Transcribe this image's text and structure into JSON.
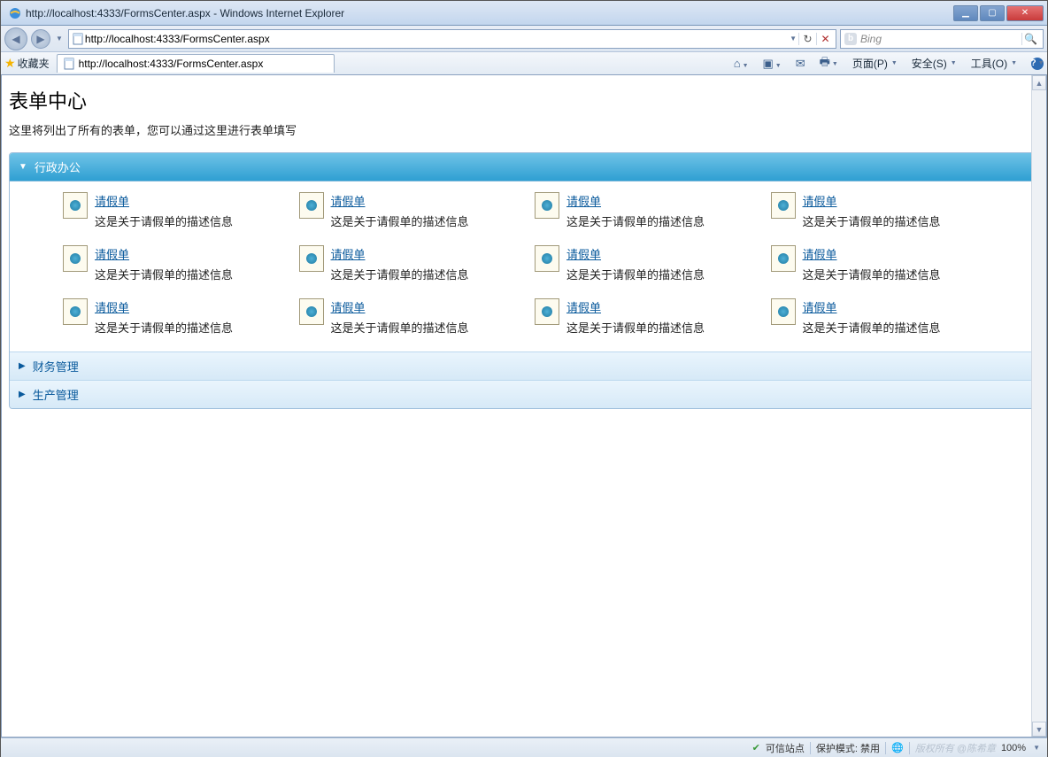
{
  "window": {
    "title": "http://localhost:4333/FormsCenter.aspx - Windows Internet Explorer",
    "url": "http://localhost:4333/FormsCenter.aspx"
  },
  "favorites": {
    "label": "收藏夹"
  },
  "tab": {
    "title": "http://localhost:4333/FormsCenter.aspx"
  },
  "search": {
    "placeholder": "Bing"
  },
  "commandbar": {
    "page": "页面(P)",
    "safety": "安全(S)",
    "tools": "工具(O)"
  },
  "page": {
    "title": "表单中心",
    "subtitle": "这里将列出了所有的表单，您可以通过这里进行表单填写"
  },
  "sections": [
    {
      "title": "行政办公",
      "expanded": true,
      "items": [
        {
          "title": "请假单",
          "desc": "这是关于请假单的描述信息"
        },
        {
          "title": "请假单",
          "desc": "这是关于请假单的描述信息"
        },
        {
          "title": "请假单",
          "desc": "这是关于请假单的描述信息"
        },
        {
          "title": "请假单",
          "desc": "这是关于请假单的描述信息"
        },
        {
          "title": "请假单",
          "desc": "这是关于请假单的描述信息"
        },
        {
          "title": "请假单",
          "desc": "这是关于请假单的描述信息"
        },
        {
          "title": "请假单",
          "desc": "这是关于请假单的描述信息"
        },
        {
          "title": "请假单",
          "desc": "这是关于请假单的描述信息"
        },
        {
          "title": "请假单",
          "desc": "这是关于请假单的描述信息"
        },
        {
          "title": "请假单",
          "desc": "这是关于请假单的描述信息"
        },
        {
          "title": "请假单",
          "desc": "这是关于请假单的描述信息"
        },
        {
          "title": "请假单",
          "desc": "这是关于请假单的描述信息"
        }
      ]
    },
    {
      "title": "财务管理",
      "expanded": false
    },
    {
      "title": "生产管理",
      "expanded": false
    }
  ],
  "status": {
    "trusted": "可信站点",
    "protected": "保护模式: 禁用",
    "zoom": "100%",
    "watermark": "版权所有 @陈希章"
  }
}
